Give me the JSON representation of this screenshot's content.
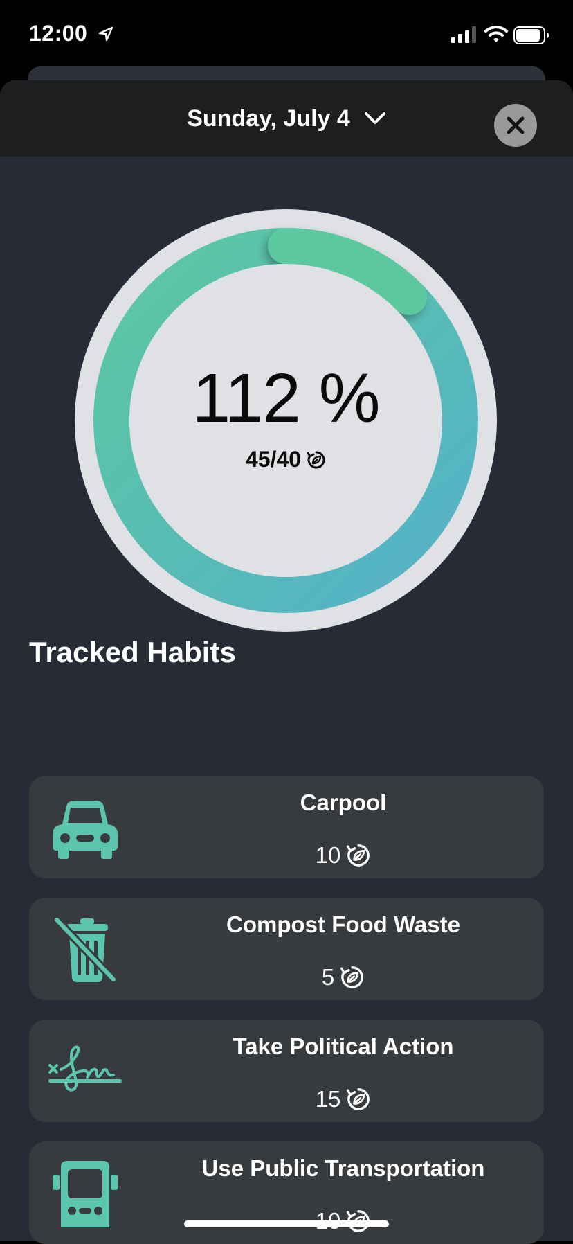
{
  "status_bar": {
    "time": "12:00"
  },
  "header": {
    "date_label": "Sunday, July 4"
  },
  "progress": {
    "percent_text": "112 %",
    "ratio_text": "45/40",
    "value": 45,
    "goal": 40,
    "colors": {
      "start": "#5cc8a0",
      "end": "#55b1c9",
      "track": "#dfe1e5"
    }
  },
  "habits_section": {
    "title": "Tracked Habits",
    "items": [
      {
        "name": "Carpool",
        "points": "10",
        "icon": "car-icon"
      },
      {
        "name": "Compost Food Waste",
        "points": "5",
        "icon": "no-trash-icon"
      },
      {
        "name": "Take Political Action",
        "points": "15",
        "icon": "signature-icon"
      },
      {
        "name": "Use Public Transportation",
        "points": "10",
        "icon": "bus-icon"
      }
    ]
  },
  "colors": {
    "accent": "#5cc5ad",
    "card": "#383b3e",
    "background": "#262b35"
  }
}
